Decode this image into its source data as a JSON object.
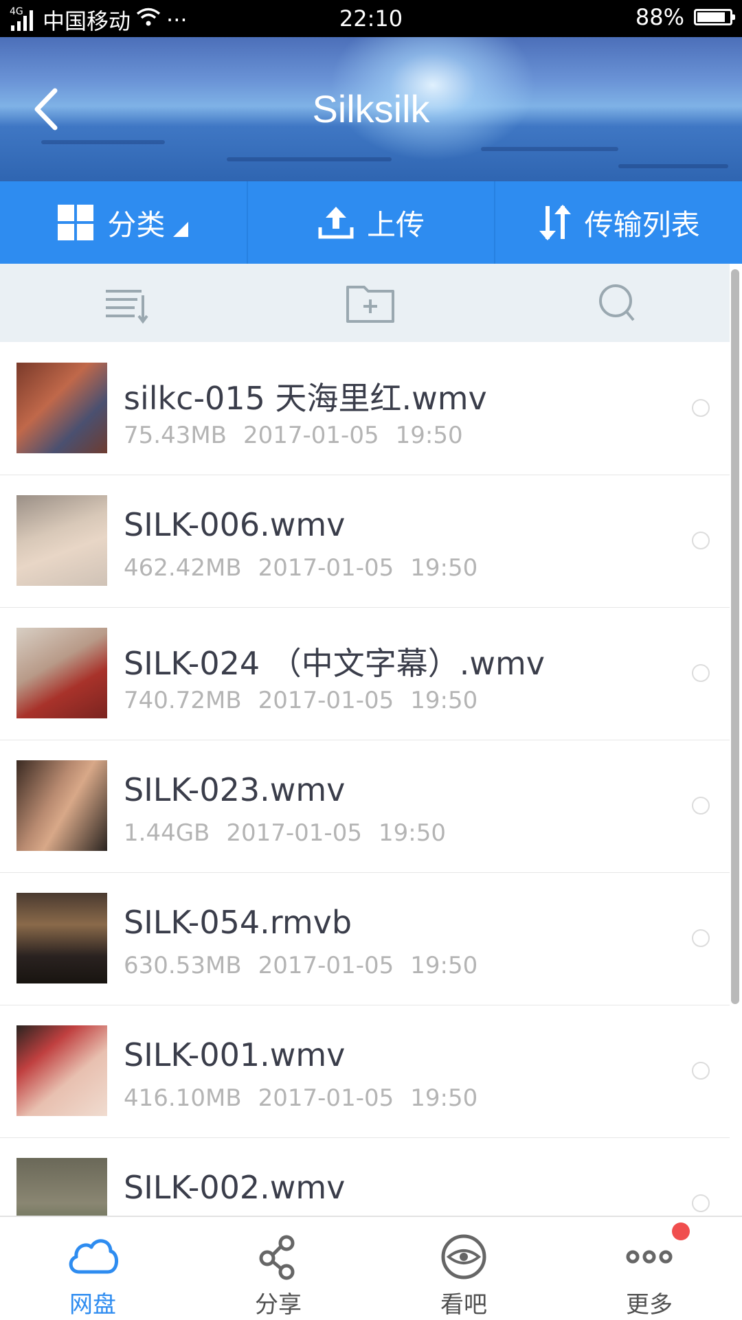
{
  "status_bar": {
    "network": "4G",
    "carrier": "中国移动",
    "extra": "···",
    "time": "22:10",
    "battery": "88%",
    "battery_level": 0.88
  },
  "header": {
    "title": "Silksilk"
  },
  "actions": [
    {
      "label": "分类",
      "icon": "grid-icon"
    },
    {
      "label": "上传",
      "icon": "upload-icon"
    },
    {
      "label": "传输列表",
      "icon": "transfer-icon"
    }
  ],
  "toolbar": {
    "sort_icon": "sort-list-icon",
    "new_folder_icon": "new-folder-icon",
    "search_icon": "search-icon"
  },
  "files": [
    {
      "name": "silkc-015 天海里红.wmv",
      "size": "75.43MB",
      "date": "2017-01-05",
      "time": "19:50"
    },
    {
      "name": "SILK-006.wmv",
      "size": "462.42MB",
      "date": "2017-01-05",
      "time": "19:50"
    },
    {
      "name": "SILK-024 （中文字幕）.wmv",
      "size": "740.72MB",
      "date": "2017-01-05",
      "time": "19:50"
    },
    {
      "name": "SILK-023.wmv",
      "size": "1.44GB",
      "date": "2017-01-05",
      "time": "19:50"
    },
    {
      "name": "SILK-054.rmvb",
      "size": "630.53MB",
      "date": "2017-01-05",
      "time": "19:50"
    },
    {
      "name": "SILK-001.wmv",
      "size": "416.10MB",
      "date": "2017-01-05",
      "time": "19:50"
    },
    {
      "name": "SILK-002.wmv",
      "size": "",
      "date": "",
      "time": ""
    }
  ],
  "bottom_nav": [
    {
      "label": "网盘",
      "icon": "cloud-icon",
      "active": true
    },
    {
      "label": "分享",
      "icon": "share-icon"
    },
    {
      "label": "看吧",
      "icon": "eye-icon"
    },
    {
      "label": "更多",
      "icon": "more-icon",
      "badge": true
    }
  ],
  "colors": {
    "brand_blue": "#2e8cf0",
    "badge_red": "#f04e4e",
    "meta_gray": "#b4b4b4"
  }
}
